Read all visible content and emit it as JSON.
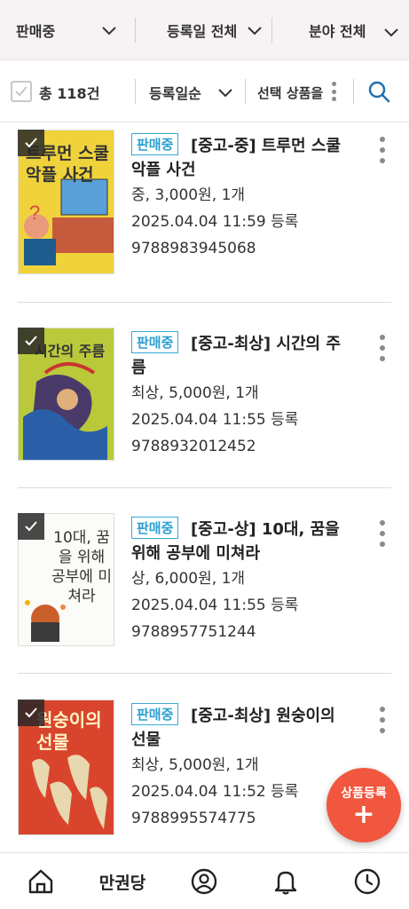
{
  "filters": {
    "status": "판매중",
    "date": "등록일 전체",
    "category": "분야 전체"
  },
  "toolbar": {
    "total": "총 118건",
    "sort": "등록일순",
    "select_action": "선택 상품을"
  },
  "items": [
    {
      "badge": "판매중",
      "title": "[중고-중] 트루먼 스쿨 악플 사건",
      "meta": "중, 3,000원, 1개",
      "date": "2025.04.04 11:59 등록",
      "isbn": "9788983945068",
      "cover_title": "트루먼 스쿨 악플 사건"
    },
    {
      "badge": "판매중",
      "title": "[중고-최상] 시간의 주름",
      "meta": "최상, 5,000원, 1개",
      "date": "2025.04.04 11:55 등록",
      "isbn": "9788932012452",
      "cover_title": "시간의 주름"
    },
    {
      "badge": "판매중",
      "title": "[중고-상] 10대, 꿈을 위해 공부에 미쳐라",
      "meta": "상, 6,000원, 1개",
      "date": "2025.04.04 11:55 등록",
      "isbn": "9788957751244",
      "cover_title": "10대, 꿈을 위해 공부에 미쳐라"
    },
    {
      "badge": "판매중",
      "title": "[중고-최상] 원숭이의 선물",
      "meta": "최상, 5,000원, 1개",
      "date": "2025.04.04 11:52 등록",
      "isbn": "9788995574775",
      "cover_title": "원숭이의 선물"
    }
  ],
  "fab": {
    "label": "상품등록",
    "plus": "+"
  },
  "bottom_nav": {
    "shop_label": "만권당"
  },
  "colors": {
    "accent": "#f0573e",
    "badge": "#2b9fd0",
    "header_bg": "#f7f2f4"
  }
}
